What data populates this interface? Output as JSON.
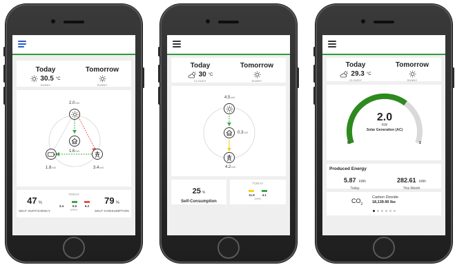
{
  "phone1": {
    "forecast": {
      "today": {
        "day": "Today",
        "temp": "30.5",
        "unit": "°C",
        "condition": "SUNNY",
        "icon": "sun-icon"
      },
      "tomorrow": {
        "day": "Tomorrow",
        "condition": "SUNNY",
        "icon": "sun-icon"
      }
    },
    "flow": {
      "solar": {
        "value": "2.0",
        "unit": "kW"
      },
      "home": {
        "value": "1.6",
        "unit": "kW"
      },
      "battery": {
        "value": "1.8",
        "unit": "kW"
      },
      "grid": {
        "value": "3.4",
        "unit": "kW"
      }
    },
    "summary": {
      "self_sufficiency": {
        "value": "47",
        "unit": "%",
        "label": "SELF-SUFFICIENCY"
      },
      "self_consumption": {
        "value": "79",
        "unit": "%",
        "label": "SELF-CONSUMPTION"
      },
      "today_label": "TODAY",
      "bars": [
        {
          "value": "3.4",
          "color": "#ffffff"
        },
        {
          "value": "5.5",
          "color": "#3aa64a"
        },
        {
          "value": "6.2",
          "color": "#e8504a"
        }
      ],
      "bar_unit": "(kWh)"
    }
  },
  "phone2": {
    "forecast": {
      "today": {
        "day": "Today",
        "temp": "30",
        "unit": "°C",
        "condition": "CLOUDY",
        "icon": "partly-cloudy-icon"
      },
      "tomorrow": {
        "day": "Tomorrow",
        "condition": "SUNNY",
        "icon": "sun-icon"
      }
    },
    "flow": {
      "solar": {
        "value": "4.5",
        "unit": "kW"
      },
      "home": {
        "value": "0.3",
        "unit": "kW"
      },
      "grid": {
        "value": "4.2",
        "unit": "kW"
      }
    },
    "summary": {
      "self_consumption": {
        "value": "25",
        "unit": "%",
        "label": "Self-Consumption"
      },
      "today_label": "TODAY",
      "bars": [
        {
          "value": "11.9",
          "color": "#f3d21c"
        },
        {
          "value": "4.1",
          "color": "#3aa64a"
        }
      ],
      "bar_unit": "(kWh)"
    }
  },
  "phone3": {
    "forecast": {
      "today": {
        "day": "Today",
        "temp": "29.3",
        "unit": "°C",
        "condition": "CLOUDY",
        "icon": "partly-cloudy-icon"
      },
      "tomorrow": {
        "day": "Tomorrow",
        "condition": "SUNNY",
        "icon": "sun-icon"
      }
    },
    "gauge": {
      "value": "2.0",
      "unit": "KW",
      "label": "Solar Generation (AC)",
      "min": "0",
      "max": "3",
      "level": 0.667
    },
    "energy": {
      "title": "Produced Energy",
      "today": {
        "value": "5.87",
        "unit": "kWh",
        "label": "Today"
      },
      "month": {
        "value": "282.61",
        "unit": "kWh",
        "label": "This Month"
      }
    },
    "co2": {
      "symbol": "CO",
      "subscript": "2",
      "title": "Carbon Dioxide",
      "value": "18,139.90 lbs",
      "pages": 6,
      "active_page": 1
    }
  },
  "colors": {
    "accent": "#2e9a3a",
    "menu_blue": "#2a5ad1",
    "grid_red": "#e8504a",
    "solar_yellow": "#f3d21c"
  }
}
